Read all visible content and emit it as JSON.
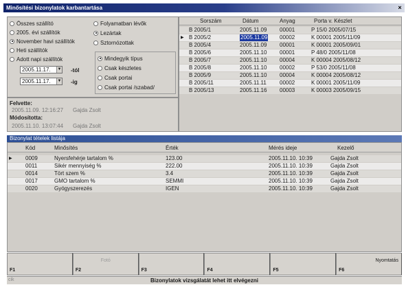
{
  "window": {
    "title": "Minősítési bizonylatok karbantartása",
    "close_symbol": "×"
  },
  "period_filter": {
    "options": [
      {
        "label": "Összes szállító",
        "selected": false
      },
      {
        "label": "2005. évi szállítók",
        "selected": false
      },
      {
        "label": "November havi szállítók",
        "selected": true
      },
      {
        "label": "Heti szállítók",
        "selected": false
      },
      {
        "label": "Adott napi szállítók",
        "selected": false
      }
    ],
    "from_date": "2005.11.17.",
    "from_label": "-tól",
    "to_date": "2005.11.17.",
    "to_label": "-ig"
  },
  "status_filter": {
    "options": [
      {
        "label": "Folyamatban lévők",
        "selected": false
      },
      {
        "label": "Lezártak",
        "selected": true
      },
      {
        "label": "Sztornózottak",
        "selected": false
      }
    ]
  },
  "type_filter": {
    "options": [
      {
        "label": "Mindegyik típus",
        "selected": true
      },
      {
        "label": "Csak készletes",
        "selected": false
      },
      {
        "label": "Csak portai",
        "selected": false
      },
      {
        "label": "Csak portai /szabad/",
        "selected": false
      }
    ]
  },
  "record_info": {
    "created_label": "Felvette:",
    "created_value": "2005.11.09. 12:16:27",
    "created_user": "Gajda Zsolt",
    "modified_label": "Módosította:",
    "modified_value": "2005.11.10. 13:07:44",
    "modified_user": "Gajda Zsolt"
  },
  "documents_grid": {
    "columns": [
      "Sorszám",
      "Dátum",
      "Anyag",
      "Porta v. Készlet"
    ],
    "rows": [
      {
        "sorszam": "B 2005/1",
        "datum": "2005.11.09",
        "anyag": "00001",
        "porta": "P 15/0  2005/07/15",
        "current": false,
        "alt": false
      },
      {
        "sorszam": "B 2005/2",
        "datum": "2005.11.09",
        "anyag": "00002",
        "porta": "K 00001  2005/11/09",
        "current": true,
        "alt": true
      },
      {
        "sorszam": "B 2005/4",
        "datum": "2005.11.09",
        "anyag": "00001",
        "porta": "K 00001  2005/09/01",
        "current": false,
        "alt": false
      },
      {
        "sorszam": "B 2005/6",
        "datum": "2005.11.10",
        "anyag": "00001",
        "porta": "P 48/0  2005/11/08",
        "current": false,
        "alt": true
      },
      {
        "sorszam": "B 2005/7",
        "datum": "2005.11.10",
        "anyag": "00004",
        "porta": "K 00004  2005/08/12",
        "current": false,
        "alt": false
      },
      {
        "sorszam": "B 2005/8",
        "datum": "2005.11.10",
        "anyag": "00002",
        "porta": "P 53/0  2005/11/08",
        "current": false,
        "alt": true
      },
      {
        "sorszam": "B 2005/9",
        "datum": "2005.11.10",
        "anyag": "00004",
        "porta": "K 00004  2005/08/12",
        "current": false,
        "alt": false
      },
      {
        "sorszam": "B 2005/11",
        "datum": "2005.11.11",
        "anyag": "00002",
        "porta": "K 00001  2005/11/09",
        "current": false,
        "alt": true
      },
      {
        "sorszam": "B 2005/13",
        "datum": "2005.11.16",
        "anyag": "00003",
        "porta": "K 00003  2005/09/15",
        "current": false,
        "alt": false
      }
    ]
  },
  "items_section": {
    "title": "Bizonylat tételek listája"
  },
  "items_grid": {
    "columns": [
      "Kód",
      "Minősítés",
      "Érték",
      "Mérés ideje",
      "Kezelő"
    ],
    "rows": [
      {
        "kod": "0009",
        "minosites": "Nyersfehérje tartalom %",
        "ertek": "123.00",
        "meres": "2005.11.10. 10:39",
        "kezelo": "Gajda Zsolt",
        "current": true,
        "alt": false
      },
      {
        "kod": "0011",
        "minosites": "Sikér mennyiség %",
        "ertek": "222.00",
        "meres": "2005.11.10. 10:39",
        "kezelo": "Gajda Zsolt",
        "current": false,
        "alt": true
      },
      {
        "kod": "0014",
        "minosites": "Tört szem %",
        "ertek": "3.4",
        "meres": "2005.11.10. 10:39",
        "kezelo": "Gajda Zsolt",
        "current": false,
        "alt": false
      },
      {
        "kod": "0017",
        "minosites": "GMO tartalom %",
        "ertek": "SEMMI",
        "meres": "2005.11.10. 10:39",
        "kezelo": "Gajda Zsolt",
        "current": false,
        "alt": true
      },
      {
        "kod": "0020",
        "minosites": "Gyógyszerezés",
        "ertek": "IGEN",
        "meres": "2005.11.10. 10:39",
        "kezelo": "Gajda Zsolt",
        "current": false,
        "alt": false
      }
    ]
  },
  "fkeys": [
    {
      "key": "F1",
      "label": ""
    },
    {
      "key": "F2",
      "label": "Fotó",
      "disabled": true
    },
    {
      "key": "F3",
      "label": ""
    },
    {
      "key": "F4",
      "label": ""
    },
    {
      "key": "F5",
      "label": ""
    },
    {
      "key": "F6",
      "label": "Nyomtatás"
    }
  ],
  "status": {
    "left": "cik",
    "message": "Bizonylatok vizsgálatát lehet itt elvégezni"
  },
  "colors": {
    "title_bar": "#10246a",
    "selection": "#1a38a0",
    "panel": "#d6d3ce"
  }
}
